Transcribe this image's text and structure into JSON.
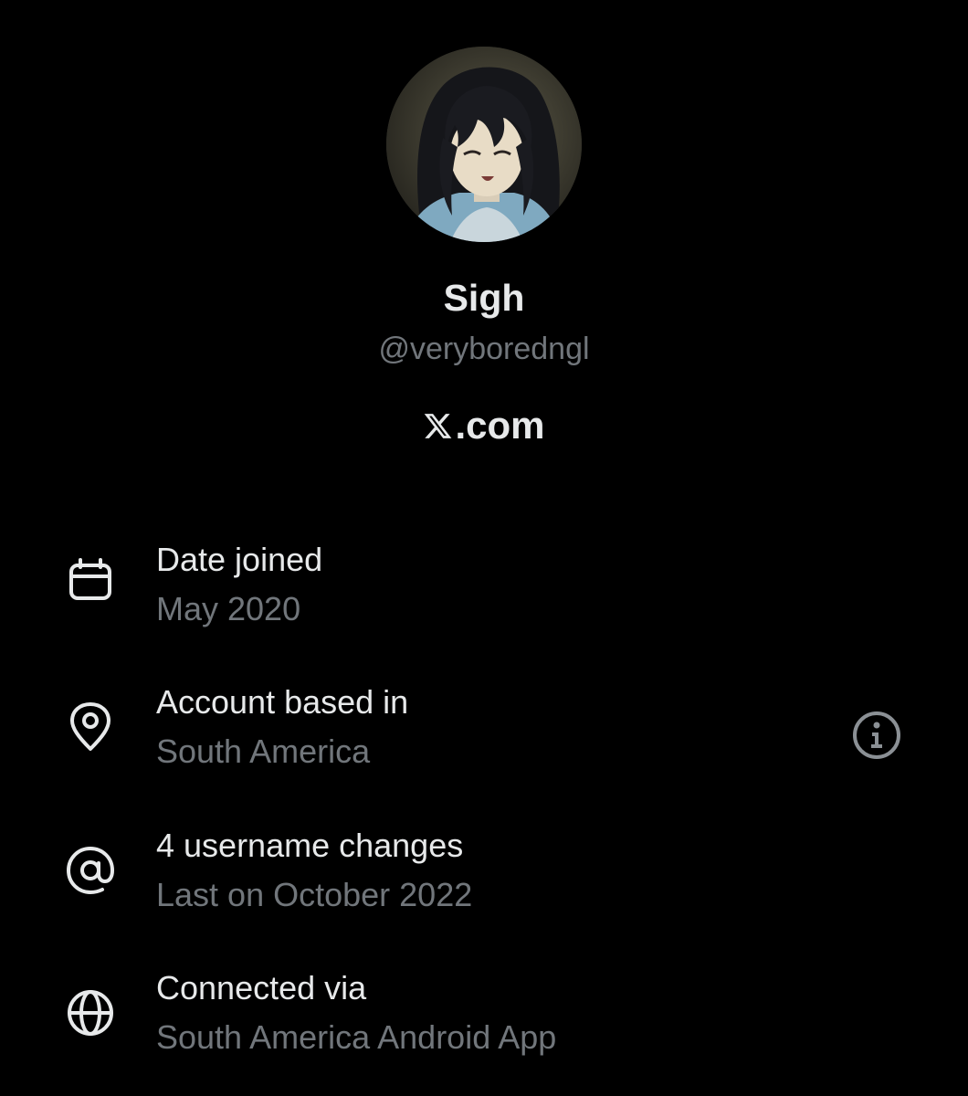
{
  "profile": {
    "display_name": "Sigh",
    "handle": "@veryboredngl",
    "site": ".com",
    "site_logo_icon": "x-logo-icon",
    "avatar_icon": "anime-avatar-image"
  },
  "about_rows": [
    {
      "icon": "calendar-icon",
      "title": "Date joined",
      "value": "May 2020"
    },
    {
      "icon": "location-pin-icon",
      "title": "Account based in",
      "value": "South America",
      "trailing_icon": "info-icon"
    },
    {
      "icon": "at-sign-icon",
      "title": "4 username changes",
      "value": "Last on October 2022"
    },
    {
      "icon": "globe-icon",
      "title": "Connected via",
      "value": "South America Android App"
    }
  ],
  "colors": {
    "background": "#000000",
    "primary_text": "#e7e9ea",
    "secondary_text": "#71767b"
  }
}
